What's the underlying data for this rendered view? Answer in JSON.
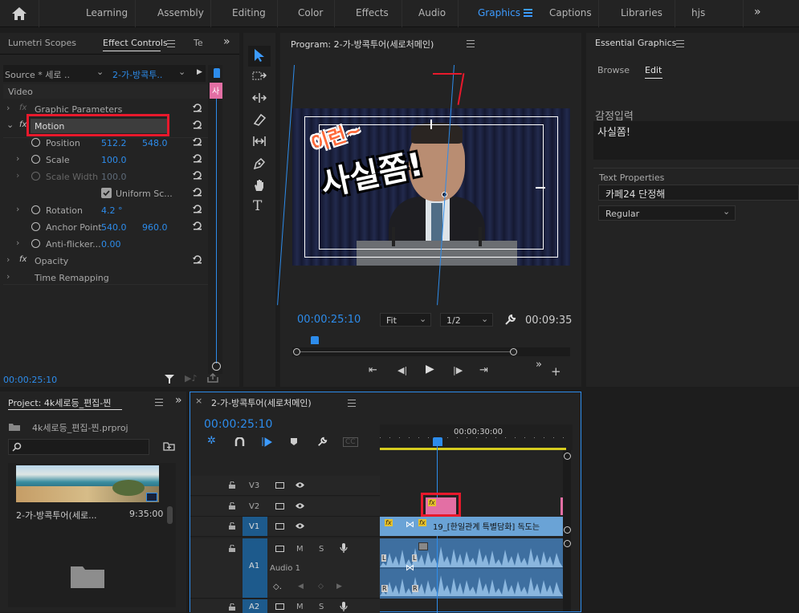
{
  "topbar": {
    "workspaces": [
      "Learning",
      "Assembly",
      "Editing",
      "Color",
      "Effects",
      "Audio",
      "Graphics",
      "Captions",
      "Libraries",
      "hjs"
    ],
    "active": "Graphics"
  },
  "effect_controls": {
    "tabs": [
      "Lumetri Scopes",
      "Effect Controls",
      "Te"
    ],
    "source": "Source * 세로 ..",
    "sequence": "2-가-방콕투..",
    "section": "Video",
    "params": {
      "graphic": "Graphic Parameters",
      "motion": "Motion",
      "position": "Position",
      "position_x": "512.2",
      "position_y": "548.0",
      "scale": "Scale",
      "scale_val": "100.0",
      "scale_width": "Scale Width",
      "scale_width_val": "100.0",
      "uniform": "Uniform Sc...",
      "rotation": "Rotation",
      "rotation_val": "4.2 °",
      "anchor": "Anchor Point",
      "anchor_x": "540.0",
      "anchor_y": "960.0",
      "antiflicker": "Anti-flicker...",
      "antiflicker_val": "0.00",
      "opacity": "Opacity",
      "time_remap": "Time Remapping"
    },
    "timecode": "00:00:25:10",
    "clip_marker": "사"
  },
  "program": {
    "title": "Program: 2-가-방콕투어(세로처메인)",
    "caption_small": "이런~",
    "caption_big": "사실쫌!",
    "timecode": "00:00:25:10",
    "fit": "Fit",
    "resolution": "1/2",
    "duration": "00:09:35"
  },
  "essential_graphics": {
    "title": "Essential Graphics",
    "tabs": [
      "Browse",
      "Edit"
    ],
    "active_tab": "Edit",
    "layer_name": "감정입력",
    "layer_text": "사실쫌!",
    "text_props": "Text Properties",
    "font": "카페24 단정해",
    "style": "Regular"
  },
  "project": {
    "title": "Project: 4k세로등_편집-찐",
    "file": "4k세로등_편집-찐.prproj",
    "item_name": "2-가-방콕투어(세로...",
    "item_duration": "9:35:00"
  },
  "timeline": {
    "title": "2-가-방콕투어(세로처메인)",
    "timecode": "00:00:25:10",
    "ruler_label": "00:00:30:00",
    "tracks": {
      "v3": "V3",
      "v2": "V2",
      "v1": "V1",
      "a1": "A1",
      "a1_name": "Audio 1",
      "a2": "A2",
      "m": "M",
      "s": "S"
    },
    "clip_v1_text": "19_[한일관계 특별담화] 독도는",
    "fx": "fx",
    "ch_l": "L",
    "ch_r": "R"
  },
  "colors": {
    "accent_blue": "#2d8ceb",
    "highlight_red": "#e8192c",
    "clip_pink": "#e36fa4",
    "clip_blue": "#4a7fb5"
  }
}
